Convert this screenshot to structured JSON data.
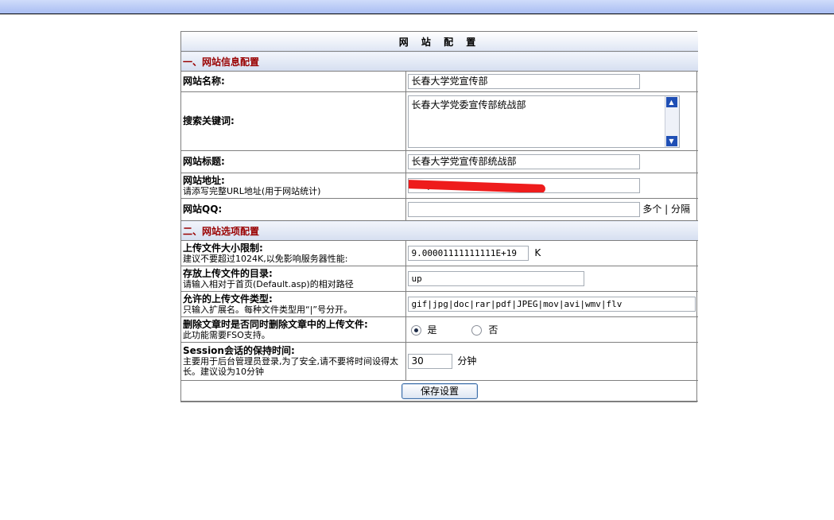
{
  "panel_title": "网 站 配 置",
  "section1_title": "一、网站信息配置",
  "site_name": {
    "label": "网站名称:",
    "value": "长春大学党宣传部"
  },
  "keywords": {
    "label": "搜索关键词:",
    "value": "长春大学党委宣传部统战部"
  },
  "site_title": {
    "label": "网站标题:",
    "value": "长春大学党宣传部统战部"
  },
  "site_url": {
    "label": "网站地址:",
    "hint": "请添写完整URL地址(用于网站统计)",
    "value": "http://                     /index.asp"
  },
  "site_qq": {
    "label": "网站QQ:",
    "value": "",
    "suffix": "多个 | 分隔"
  },
  "section2_title": "二、网站选项配置",
  "upload_limit": {
    "label": "上传文件大小限制:",
    "hint": "建议不要超过1024K,以免影响服务器性能:",
    "value": "9.00001111111111E+19",
    "unit": "K"
  },
  "upload_dir": {
    "label": "存放上传文件的目录:",
    "hint": "请输入相对于首页(Default.asp)的相对路径",
    "value": "up"
  },
  "upload_types": {
    "label": "允许的上传文件类型:",
    "hint": "只输入扩展名。每种文件类型用“|”号分开。",
    "value": "gif|jpg|doc|rar|pdf|JPEG|mov|avi|wmv|flv"
  },
  "delete_uploads": {
    "label": "删除文章时是否同时删除文章中的上传文件:",
    "hint": "此功能需要FSO支持。",
    "yes": "是",
    "no": "否",
    "selected": "是"
  },
  "session": {
    "label": "Session会话的保持时间:",
    "hint": "主要用于后台管理员登录,为了安全,请不要将时间设得太长。建议设为10分钟",
    "value": "30",
    "unit": "分钟"
  },
  "save_label": "保存设置",
  "colors": {
    "section_text": "#990000",
    "topbar": "#a9bdf2"
  }
}
